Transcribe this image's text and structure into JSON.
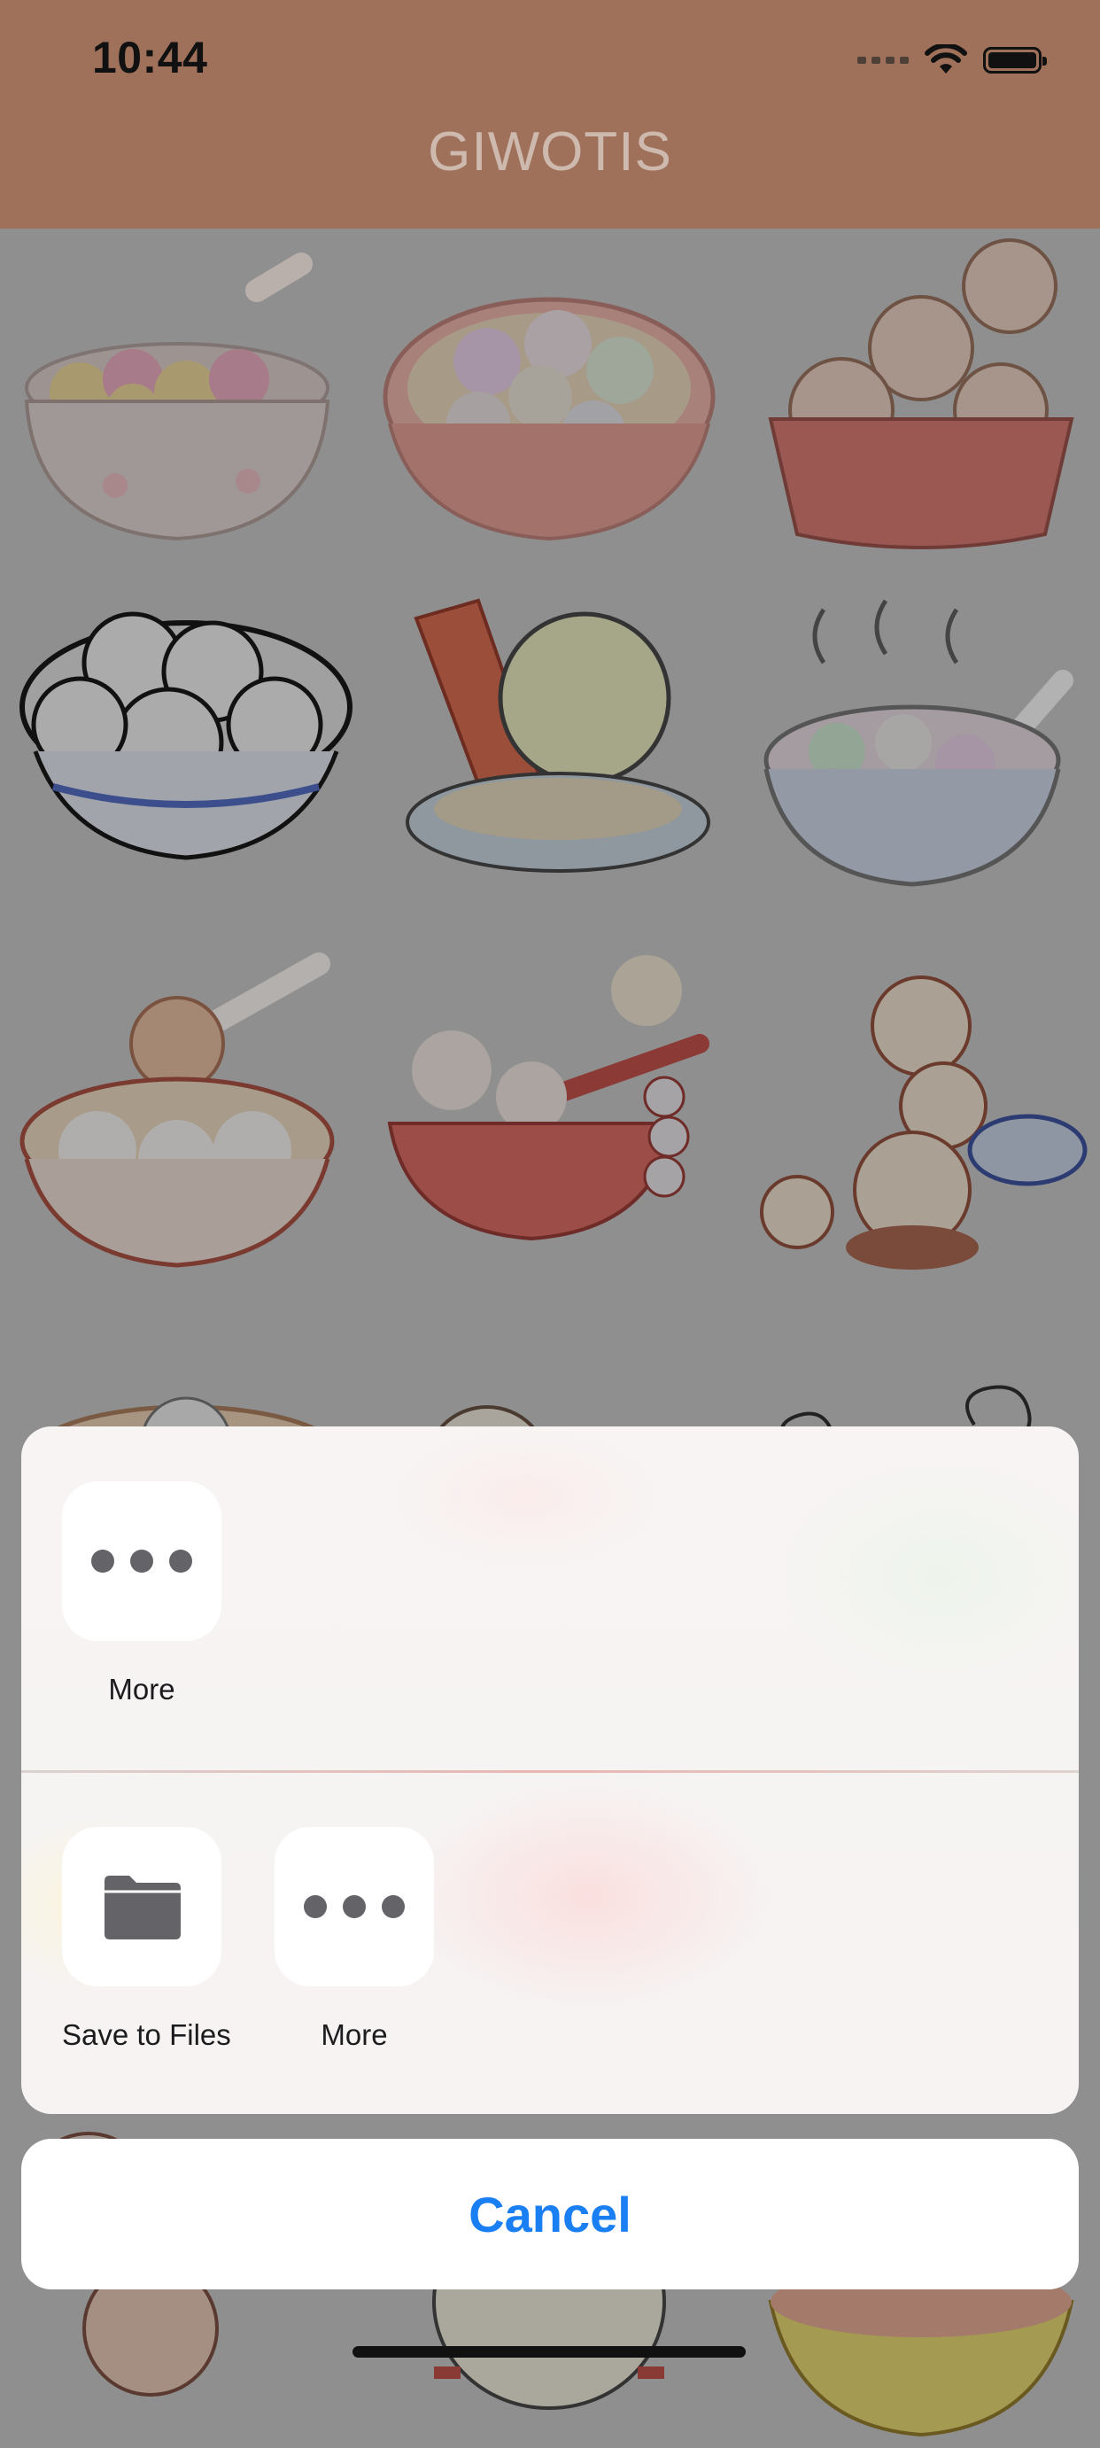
{
  "status_bar": {
    "time": "10:44"
  },
  "nav": {
    "title": "GIWOTIS"
  },
  "grid": {
    "items": [
      "bowl-sakura-tangyuan",
      "bowl-colorful-animal-tangyuan",
      "bowl-smiling-tangyuan",
      "bowl-blue-pattern-faces",
      "bowl-scroll-character",
      "bowl-pastel-tangyuan-spoon",
      "bowl-cat-on-spoon",
      "bowl-red-dumpling-characters",
      "stacked-tangyuan-faces"
    ]
  },
  "share_sheet": {
    "top_row": [
      {
        "label": "More",
        "icon": "more-dots-icon"
      }
    ],
    "action_row": [
      {
        "label": "Save to Files",
        "icon": "folder-icon"
      },
      {
        "label": "More",
        "icon": "more-dots-icon"
      }
    ],
    "cancel_label": "Cancel",
    "accent_color": "#1a7ff2"
  }
}
